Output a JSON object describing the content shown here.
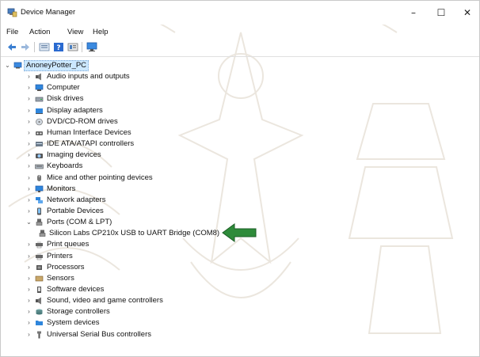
{
  "window": {
    "title": "Device Manager",
    "minimize": "–",
    "maximize": "☐",
    "close": "✕"
  },
  "menu": {
    "items": [
      "File",
      "Action",
      "View",
      "Help"
    ]
  },
  "toolbar": {
    "buttons": [
      "back-icon",
      "forward-icon",
      "properties-icon",
      "help-icon",
      "details-icon",
      "monitor-icon"
    ]
  },
  "tree": {
    "root": "AnoneyPotter_PC",
    "items": [
      {
        "label": "Audio inputs and outputs",
        "icon": "speaker-icon",
        "expanded": false
      },
      {
        "label": "Computer",
        "icon": "computer-icon",
        "expanded": false
      },
      {
        "label": "Disk drives",
        "icon": "disk-drive-icon",
        "expanded": false
      },
      {
        "label": "Display adapters",
        "icon": "display-adapter-icon",
        "expanded": false
      },
      {
        "label": "DVD/CD-ROM drives",
        "icon": "dvd-drive-icon",
        "expanded": false
      },
      {
        "label": "Human Interface Devices",
        "icon": "hid-icon",
        "expanded": false
      },
      {
        "label": "IDE ATA/ATAPI controllers",
        "icon": "ide-controller-icon",
        "expanded": false
      },
      {
        "label": "Imaging devices",
        "icon": "camera-icon",
        "expanded": false
      },
      {
        "label": "Keyboards",
        "icon": "keyboard-icon",
        "expanded": false
      },
      {
        "label": "Mice and other pointing devices",
        "icon": "mouse-icon",
        "expanded": false
      },
      {
        "label": "Monitors",
        "icon": "monitor-icon",
        "expanded": false
      },
      {
        "label": "Network adapters",
        "icon": "network-icon",
        "expanded": false
      },
      {
        "label": "Portable Devices",
        "icon": "portable-device-icon",
        "expanded": false
      },
      {
        "label": "Ports (COM & LPT)",
        "icon": "port-icon",
        "expanded": true
      },
      {
        "label": "Silicon Labs CP210x USB to UART Bridge (COM8)",
        "icon": "port-icon",
        "child": true
      },
      {
        "label": "Print queues",
        "icon": "printer-icon",
        "expanded": false
      },
      {
        "label": "Printers",
        "icon": "printer-icon",
        "expanded": false
      },
      {
        "label": "Processors",
        "icon": "processor-icon",
        "expanded": false
      },
      {
        "label": "Sensors",
        "icon": "sensor-icon",
        "expanded": false
      },
      {
        "label": "Software devices",
        "icon": "software-device-icon",
        "expanded": false
      },
      {
        "label": "Sound, video and game controllers",
        "icon": "speaker-icon",
        "expanded": false
      },
      {
        "label": "Storage controllers",
        "icon": "storage-icon",
        "expanded": false
      },
      {
        "label": "System devices",
        "icon": "folder-icon",
        "expanded": false
      },
      {
        "label": "Universal Serial Bus controllers",
        "icon": "usb-icon",
        "expanded": false
      }
    ]
  },
  "annotation": {
    "arrow_color": "#2e8b3a",
    "arrow_icon": "green-arrow-icon"
  },
  "colors": {
    "selection_bg": "#cce8ff",
    "icon_blue": "#1e78d4"
  }
}
